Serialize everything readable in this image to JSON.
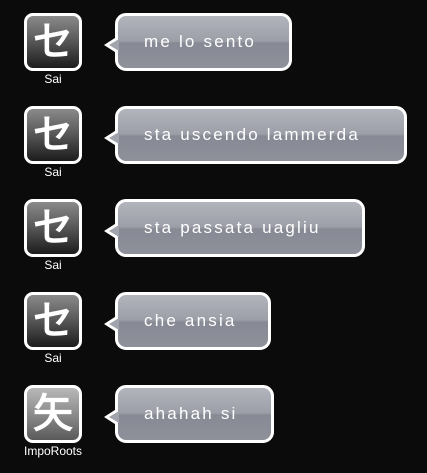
{
  "messages": [
    {
      "user": "Sai",
      "avatar_glyph": "セ",
      "text": "me lo sento"
    },
    {
      "user": "Sai",
      "avatar_glyph": "セ",
      "text": "sta uscendo lammerda"
    },
    {
      "user": "Sai",
      "avatar_glyph": "セ",
      "text": "sta passata uagliu"
    },
    {
      "user": "Sai",
      "avatar_glyph": "セ",
      "text": "che ansia"
    },
    {
      "user": "ImpoRoots",
      "avatar_glyph": "矢",
      "text": "ahahah si"
    }
  ],
  "colors": {
    "background": "#0b0b0b",
    "bubble": "#9d9fa8",
    "border": "#ffffff"
  }
}
